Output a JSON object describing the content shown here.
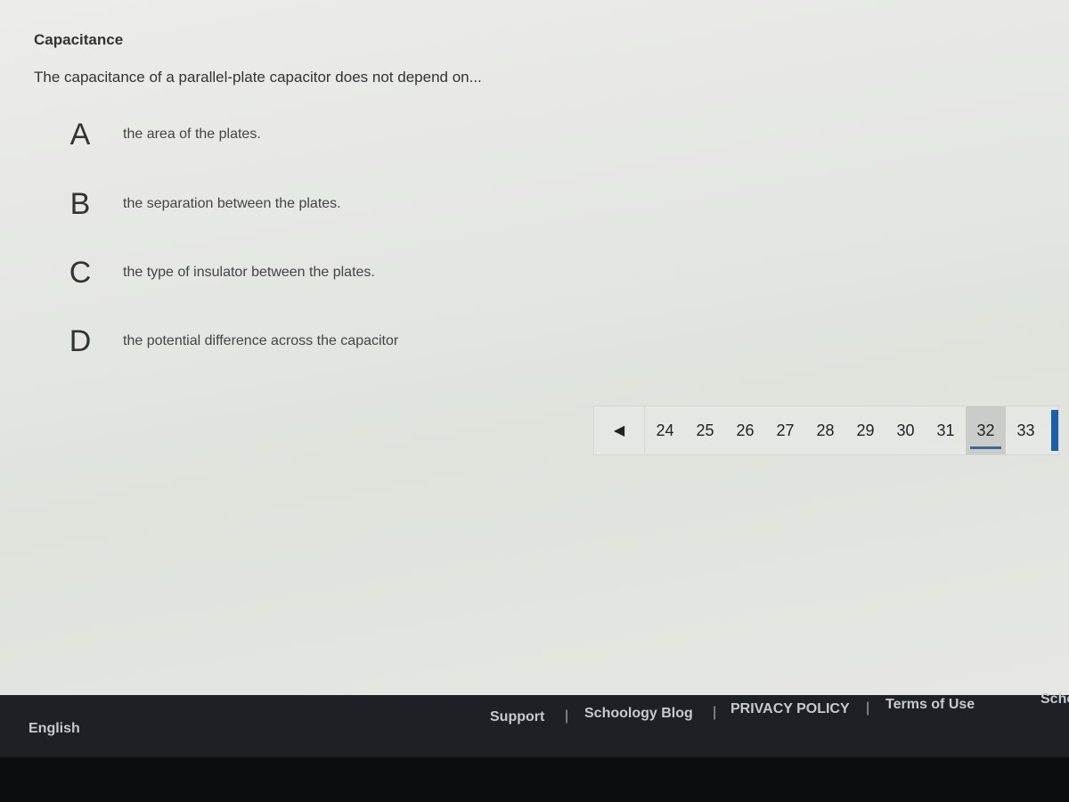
{
  "question": {
    "title": "Capacitance",
    "prompt": "The capacitance of a parallel-plate capacitor does not depend on...",
    "choices": [
      {
        "letter": "A",
        "text": "the area of the plates."
      },
      {
        "letter": "B",
        "text": "the separation between the plates."
      },
      {
        "letter": "C",
        "text": "the type of insulator between the plates."
      },
      {
        "letter": "D",
        "text": "the potential difference across the capacitor"
      }
    ]
  },
  "pagination": {
    "prev_icon": "triangle-left-icon",
    "pages": [
      "24",
      "25",
      "26",
      "27",
      "28",
      "29",
      "30",
      "31",
      "32",
      "33"
    ],
    "current": "32",
    "accent": "#2b6cb0"
  },
  "footer": {
    "language": "English",
    "links": [
      "Support",
      "Schoology Blog",
      "PRIVACY POLICY",
      "Terms of Use"
    ],
    "separator": "|",
    "truncated": "Scho"
  }
}
